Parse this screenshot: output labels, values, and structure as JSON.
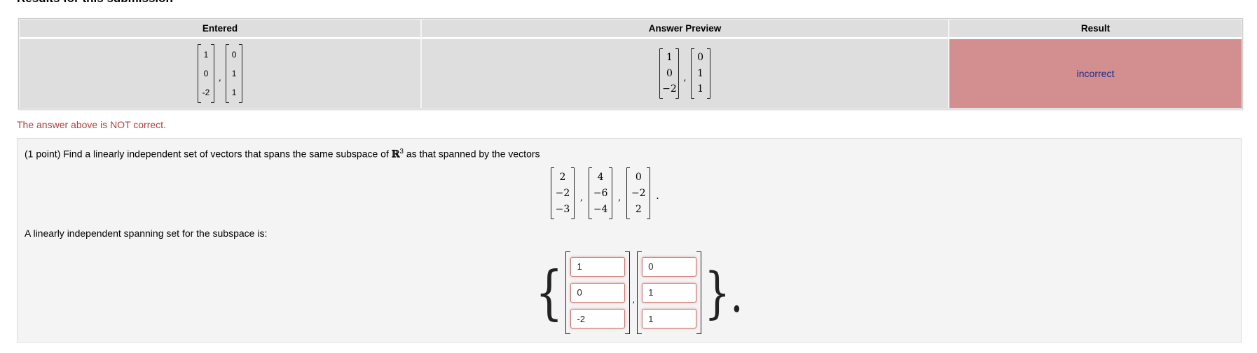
{
  "page": {
    "heading": "Results for this submission"
  },
  "results": {
    "headers": {
      "entered": "Entered",
      "preview": "Answer Preview",
      "result": "Result"
    },
    "entered": {
      "v1": [
        "1",
        "0",
        "-2"
      ],
      "v2": [
        "0",
        "1",
        "1"
      ],
      "separator": ","
    },
    "preview": {
      "v1": [
        "1",
        "0",
        "−2"
      ],
      "v2": [
        "0",
        "1",
        "1"
      ],
      "separator": ","
    },
    "result": "incorrect",
    "result_color": "#d38f8f"
  },
  "feedback": {
    "message": "The answer above is NOT correct.",
    "color": "#b04040"
  },
  "problem": {
    "prefix": "(1 point) Find a linearly independent set of vectors that spans the same subspace of",
    "space_symbol": "ℝ",
    "space_exp": "3",
    "suffix": "as that spanned by the vectors",
    "vectors": [
      [
        "2",
        "−2",
        "−3"
      ],
      [
        "4",
        "−6",
        "−4"
      ],
      [
        "0",
        "−2",
        "2"
      ]
    ],
    "separator": ",",
    "period": ".",
    "answer_label": "A linearly independent spanning set for the subspace is:",
    "left_brace": "{",
    "right_brace": "}.",
    "answer_separator": ",",
    "inputs": {
      "v1": [
        "1",
        "0",
        "-2"
      ],
      "v2": [
        "0",
        "1",
        "1"
      ]
    }
  }
}
